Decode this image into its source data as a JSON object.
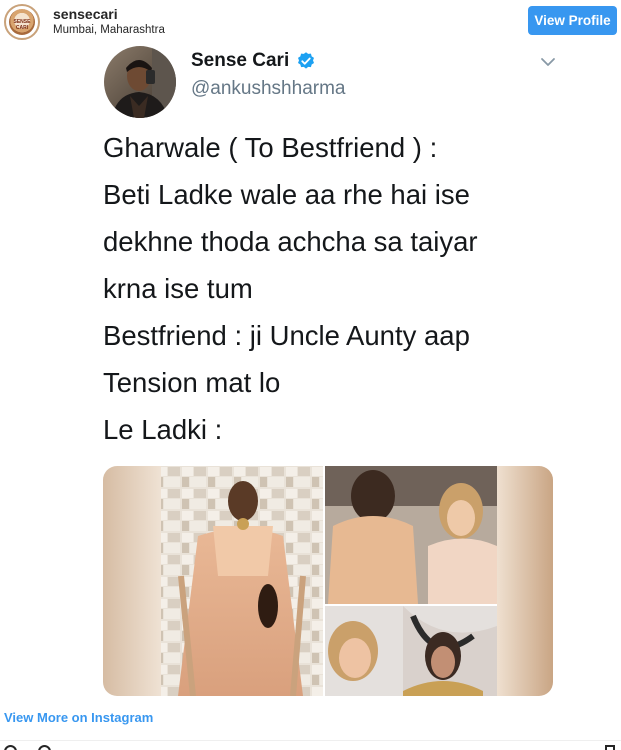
{
  "instagram": {
    "username": "sensecari",
    "location": "Mumbai, Maharashtra",
    "avatar_text": "SENSE CARI",
    "view_profile_label": "View Profile",
    "view_more_label": "View More on Instagram"
  },
  "tweet": {
    "display_name": "Sense Cari",
    "handle": "@ankushshharma",
    "verified": true,
    "lines": [
      "Gharwale ( To Bestfriend ) :",
      "Beti Ladke wale aa rhe hai ise",
      "dekhne thoda achcha sa taiyar",
      "krna ise tum",
      "Bestfriend : ji Uncle Aunty aap",
      "Tension mat lo",
      "Le Ladki :"
    ]
  },
  "colors": {
    "instagram_blue": "#3897f0",
    "twitter_verified": "#1da1f2",
    "handle_grey": "#657786"
  },
  "icons": [
    "verified-badge-icon",
    "chevron-down-icon",
    "heart-icon",
    "comment-icon",
    "bookmark-icon"
  ]
}
